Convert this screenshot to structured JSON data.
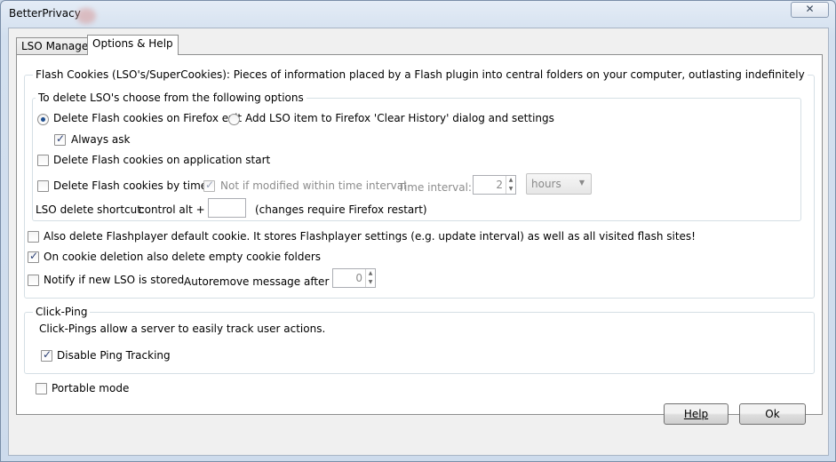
{
  "window": {
    "title": "BetterPrivacy",
    "close_glyph": "✕"
  },
  "tabs": [
    {
      "label": "LSO Manager",
      "selected": false
    },
    {
      "label": "Options & Help",
      "selected": true
    }
  ],
  "flash_group": {
    "legend": "Flash Cookies (LSO's/SuperCookies): Pieces of information placed by a Flash plugin into central folders on your computer, outlasting indefinitely",
    "delete_group": {
      "legend": "To delete LSO's choose from the following options",
      "radio_exit": {
        "label": "Delete Flash cookies on Firefox exit",
        "checked": true
      },
      "radio_clear_history": {
        "label": "Add LSO item to Firefox 'Clear History' dialog and settings",
        "checked": false
      },
      "always_ask": {
        "label": "Always ask",
        "checked": true
      },
      "on_start": {
        "label": "Delete Flash cookies on application start",
        "checked": false
      },
      "by_timer": {
        "label": "Delete Flash cookies by timer",
        "checked": false
      },
      "not_modified": {
        "label": "Not if modified within time interval",
        "checked": true,
        "disabled": true
      },
      "time_interval_label": "Time interval:",
      "time_interval_value": "2",
      "time_unit": "hours",
      "shortcut_label": "LSO delete shortcut:",
      "shortcut_prefix": "control alt +",
      "shortcut_value": "",
      "shortcut_note": "(changes require Firefox restart)"
    },
    "default_cookie": {
      "label": "Also delete Flashplayer default cookie. It stores Flashplayer settings (e.g. update interval) as well as all visited flash sites!",
      "checked": false
    },
    "empty_cookie": {
      "label": "On cookie deletion also delete empty cookie folders",
      "checked": true
    },
    "notify": {
      "label": "Notify if new LSO is stored",
      "checked": false
    },
    "autoremove_label": "Autoremove message after [s]",
    "autoremove_value": "0"
  },
  "click_ping": {
    "legend": "Click-Ping",
    "description": "Click-Pings allow a server to easily track user actions.",
    "disable_ping": {
      "label": "Disable Ping Tracking",
      "checked": true
    }
  },
  "portable": {
    "label": "Portable mode",
    "checked": false
  },
  "buttons": {
    "help_label": "Help",
    "ok_label": "Ok"
  },
  "colors": {
    "window_frame": "#7a8ea8",
    "check_mark": "#2a3f75",
    "group_border": "#d5dfe5"
  }
}
